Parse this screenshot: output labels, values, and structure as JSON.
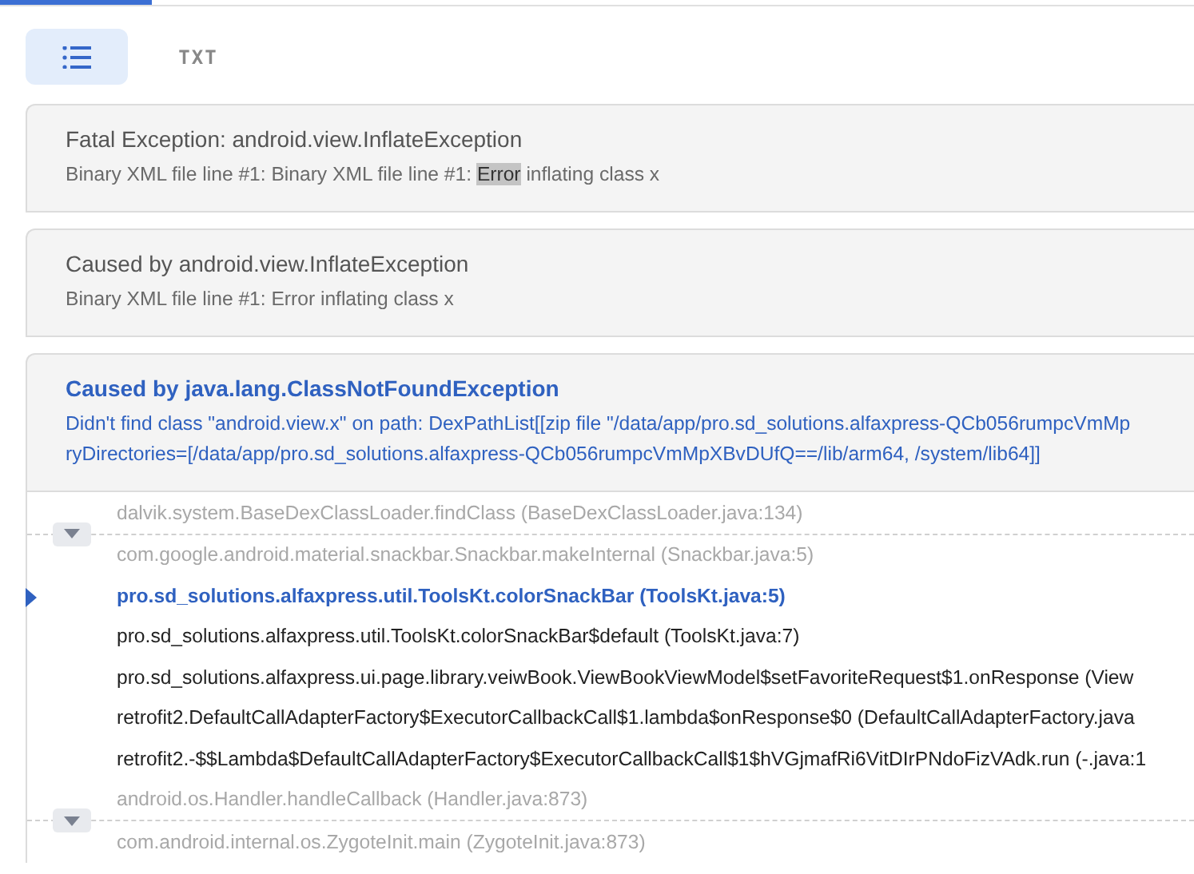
{
  "view_options": [
    {
      "kind": "list",
      "selected": true
    },
    {
      "kind": "txt",
      "label": "TXT",
      "selected": false
    }
  ],
  "exceptions": [
    {
      "title": "Fatal Exception: android.view.InflateException",
      "highlighted": false,
      "message_parts": [
        {
          "text": "Binary XML file line #1: Binary XML file line #1: ",
          "marked": false
        },
        {
          "text": "Error",
          "marked": true
        },
        {
          "text": " inflating class x",
          "marked": false
        }
      ]
    },
    {
      "title": "Caused by android.view.InflateException",
      "highlighted": false,
      "message_parts": [
        {
          "text": "Binary XML file line #1: Error inflating class x",
          "marked": false
        }
      ]
    },
    {
      "title": "Caused by java.lang.ClassNotFoundException",
      "highlighted": true,
      "message_parts": [
        {
          "text": "Didn't find class \"android.view.x\" on path: DexPathList[[zip file \"/data/app/pro.sd_solutions.alfaxpress-QCb056rumpcVmMp",
          "marked": false
        }
      ],
      "message_continued": "ryDirectories=[/data/app/pro.sd_solutions.alfaxpress-QCb056rumpcVmMpXBvDUfQ==/lib/arm64, /system/lib64]]"
    }
  ],
  "frames": [
    {
      "kind": "group",
      "expanded": false,
      "frames": [
        "dalvik.system.BaseDexClassLoader.findClass (BaseDexClassLoader.java:134)",
        "com.google.android.material.snackbar.Snackbar.makeInternal (Snackbar.java:5)"
      ]
    },
    {
      "kind": "frame",
      "text": "pro.sd_solutions.alfaxpress.util.ToolsKt.colorSnackBar (ToolsKt.java:5)",
      "selected": true
    },
    {
      "kind": "frame",
      "text": "pro.sd_solutions.alfaxpress.util.ToolsKt.colorSnackBar$default (ToolsKt.java:7)",
      "selected": false
    },
    {
      "kind": "frame",
      "text": "pro.sd_solutions.alfaxpress.ui.page.library.veiwBook.ViewBookViewModel$setFavoriteRequest$1.onResponse (View",
      "selected": false
    },
    {
      "kind": "frame",
      "text": "retrofit2.DefaultCallAdapterFactory$ExecutorCallbackCall$1.lambda$onResponse$0 (DefaultCallAdapterFactory.java",
      "selected": false
    },
    {
      "kind": "frame",
      "text": "retrofit2.-$$Lambda$DefaultCallAdapterFactory$ExecutorCallbackCall$1$hVGjmafRi6VitDIrPNdoFizVAdk.run (-.java:1",
      "selected": false
    },
    {
      "kind": "group",
      "expanded": false,
      "frames": [
        "android.os.Handler.handleCallback (Handler.java:873)",
        "com.android.internal.os.ZygoteInit.main (ZygoteInit.java:873)"
      ]
    }
  ]
}
